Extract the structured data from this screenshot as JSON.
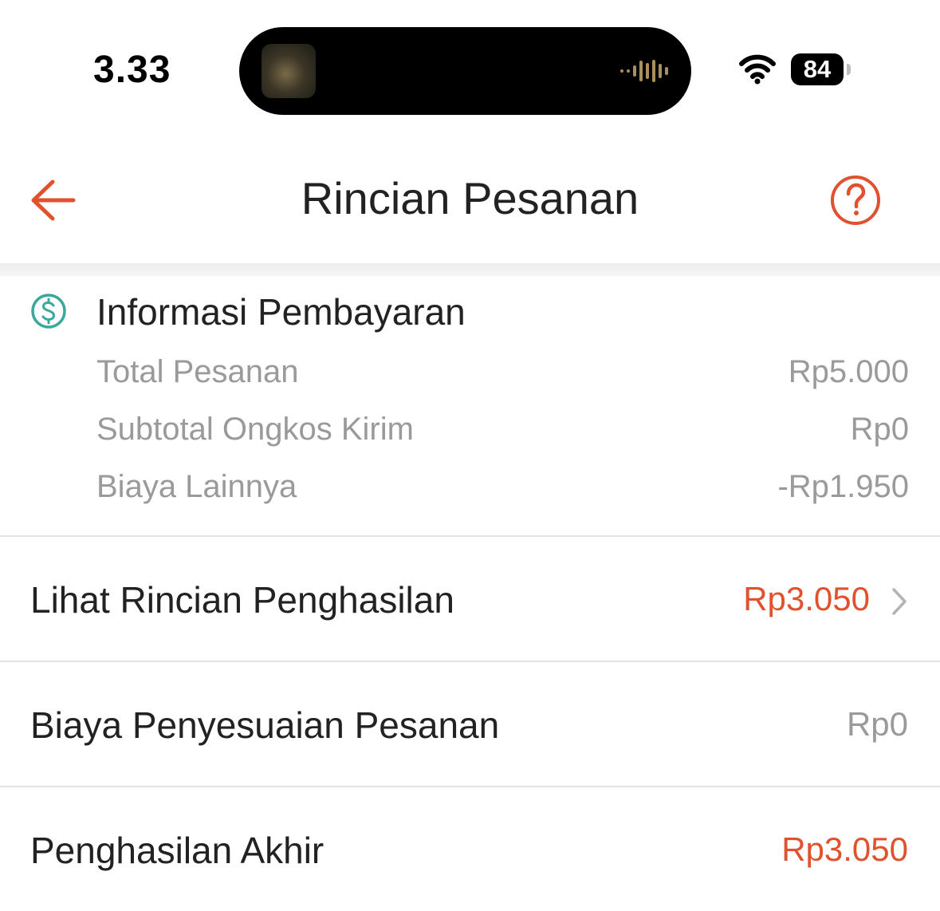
{
  "status_bar": {
    "time": "3.33",
    "battery_level": "84",
    "icons": [
      "wifi-icon",
      "battery-icon",
      "now-playing-waveform-icon"
    ]
  },
  "header": {
    "title": "Rincian Pesanan",
    "back_icon": "arrow-left-icon",
    "help_icon": "question-circle-icon"
  },
  "payment_info": {
    "icon": "dollar-circle-icon",
    "title": "Informasi Pembayaran",
    "rows": [
      {
        "label": "Total Pesanan",
        "value": "Rp5.000"
      },
      {
        "label": "Subtotal Ongkos Kirim",
        "value": "Rp0"
      },
      {
        "label": "Biaya Lainnya",
        "value": "-Rp1.950"
      }
    ]
  },
  "income_details": {
    "label": "Lihat Rincian Penghasilan",
    "value": "Rp3.050",
    "icon": "chevron-right-icon"
  },
  "adjustment_fee": {
    "label": "Biaya Penyesuaian Pesanan",
    "value": "Rp0"
  },
  "final_income": {
    "label": "Penghasilan Akhir",
    "value": "Rp3.050"
  },
  "colors": {
    "accent": "#e0522e",
    "icon_teal": "#3aa89a",
    "muted_text": "#9a9a9a",
    "primary_text": "#222222"
  }
}
